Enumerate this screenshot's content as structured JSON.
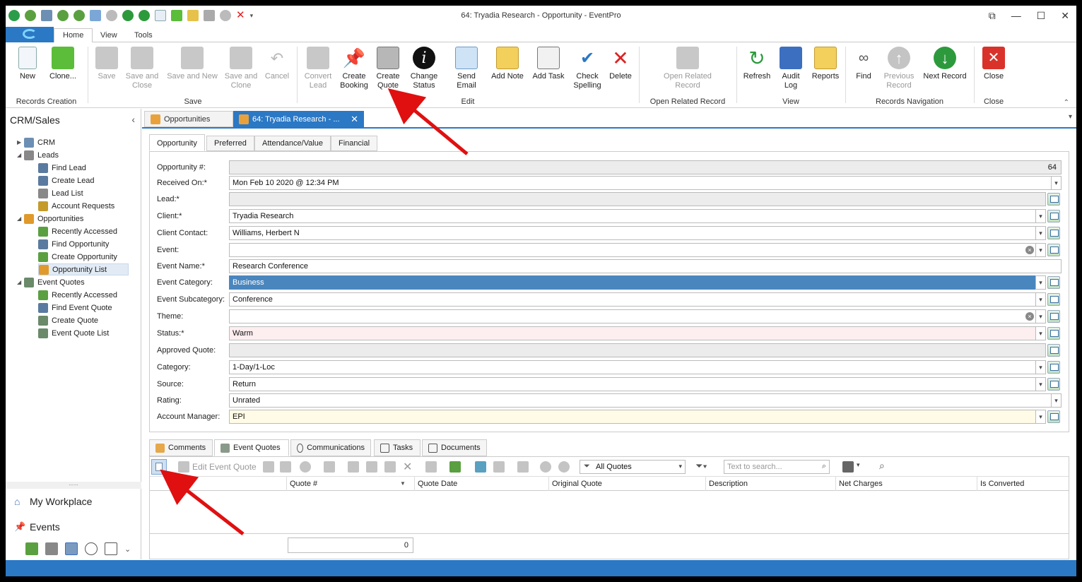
{
  "window": {
    "title": "64: Tryadia Research - Opportunity - EventPro"
  },
  "ribbon_tabs": [
    "Home",
    "View",
    "Tools"
  ],
  "ribbon": {
    "records_creation": {
      "label": "Records Creation",
      "new": "New",
      "clone": "Clone..."
    },
    "save": {
      "label": "Save",
      "save": "Save",
      "save_close": "Save and Close",
      "save_new": "Save and New",
      "save_clone": "Save and Clone",
      "cancel": "Cancel"
    },
    "edit": {
      "label": "Edit",
      "convert_lead": "Convert Lead",
      "create_booking": "Create Booking",
      "create_quote": "Create Quote",
      "change_status": "Change Status",
      "send_email": "Send Email",
      "add_note": "Add Note",
      "add_task": "Add Task",
      "check_spelling": "Check Spelling",
      "delete": "Delete"
    },
    "open_related": {
      "label": "Open Related Record",
      "open_related_record": "Open Related Record"
    },
    "view": {
      "label": "View",
      "refresh": "Refresh",
      "audit_log": "Audit Log",
      "reports": "Reports"
    },
    "records_navigation": {
      "label": "Records Navigation",
      "find": "Find",
      "previous_record": "Previous Record",
      "next_record": "Next Record"
    },
    "close": {
      "label": "Close",
      "close": "Close"
    }
  },
  "sidebar": {
    "title": "CRM/Sales",
    "tree": [
      {
        "label": "CRM",
        "level": 0,
        "expander": "▶"
      },
      {
        "label": "Leads",
        "level": 0,
        "expander": "◢"
      },
      {
        "label": "Find Lead",
        "level": 1
      },
      {
        "label": "Create Lead",
        "level": 1
      },
      {
        "label": "Lead List",
        "level": 1
      },
      {
        "label": "Account Requests",
        "level": 1
      },
      {
        "label": "Opportunities",
        "level": 0,
        "expander": "◢"
      },
      {
        "label": "Recently Accessed",
        "level": 1
      },
      {
        "label": "Find Opportunity",
        "level": 1
      },
      {
        "label": "Create Opportunity",
        "level": 1
      },
      {
        "label": "Opportunity List",
        "level": 1,
        "selected": true
      },
      {
        "label": "Event Quotes",
        "level": 0,
        "expander": "◢"
      },
      {
        "label": "Recently Accessed",
        "level": 1
      },
      {
        "label": "Find Event Quote",
        "level": 1
      },
      {
        "label": "Create Quote",
        "level": 1
      },
      {
        "label": "Event Quote List",
        "level": 1
      }
    ],
    "grip": "......",
    "my_workplace": "My Workplace",
    "events": "Events"
  },
  "doc_tabs": {
    "opportunities": "Opportunities",
    "current": "64: Tryadia Research - ..."
  },
  "form_tabs": [
    "Opportunity",
    "Preferred",
    "Attendance/Value",
    "Financial"
  ],
  "fields": {
    "opportunity_no": {
      "label": "Opportunity #:",
      "value": "64"
    },
    "received_on": {
      "label": "Received On:*",
      "value": "Mon Feb 10 2020 @ 12:34 PM"
    },
    "lead": {
      "label": "Lead:*",
      "value": ""
    },
    "client": {
      "label": "Client:*",
      "value": "Tryadia Research"
    },
    "client_contact": {
      "label": "Client Contact:",
      "value": "Williams, Herbert N"
    },
    "event": {
      "label": "Event:",
      "value": ""
    },
    "event_name": {
      "label": "Event Name:*",
      "value": "Research Conference"
    },
    "event_category": {
      "label": "Event Category:",
      "value": "Business"
    },
    "event_subcategory": {
      "label": "Event Subcategory:",
      "value": "Conference"
    },
    "theme": {
      "label": "Theme:",
      "value": ""
    },
    "status": {
      "label": "Status:*",
      "value": "Warm"
    },
    "approved_quote": {
      "label": "Approved Quote:",
      "value": ""
    },
    "category": {
      "label": "Category:",
      "value": "1-Day/1-Loc"
    },
    "source": {
      "label": "Source:",
      "value": "Return"
    },
    "rating": {
      "label": "Rating:",
      "value": "Unrated"
    },
    "account_manager": {
      "label": "Account Manager:",
      "value": "EPI"
    }
  },
  "bottom_tabs": [
    "Comments",
    "Event Quotes",
    "Communications",
    "Tasks",
    "Documents"
  ],
  "quotes_toolbar": {
    "edit_event_quote": "Edit Event Quote",
    "filter_value": "All Quotes",
    "search_placeholder": "Text to search..."
  },
  "quotes_grid": {
    "columns": [
      "St",
      "Quote #",
      "Quote Date",
      "Original Quote",
      "Description",
      "Net Charges",
      "Is Converted"
    ],
    "rows": [],
    "summary_value": "0"
  },
  "colors": {
    "accent": "#2b78c5",
    "arrow": "#e01010"
  }
}
